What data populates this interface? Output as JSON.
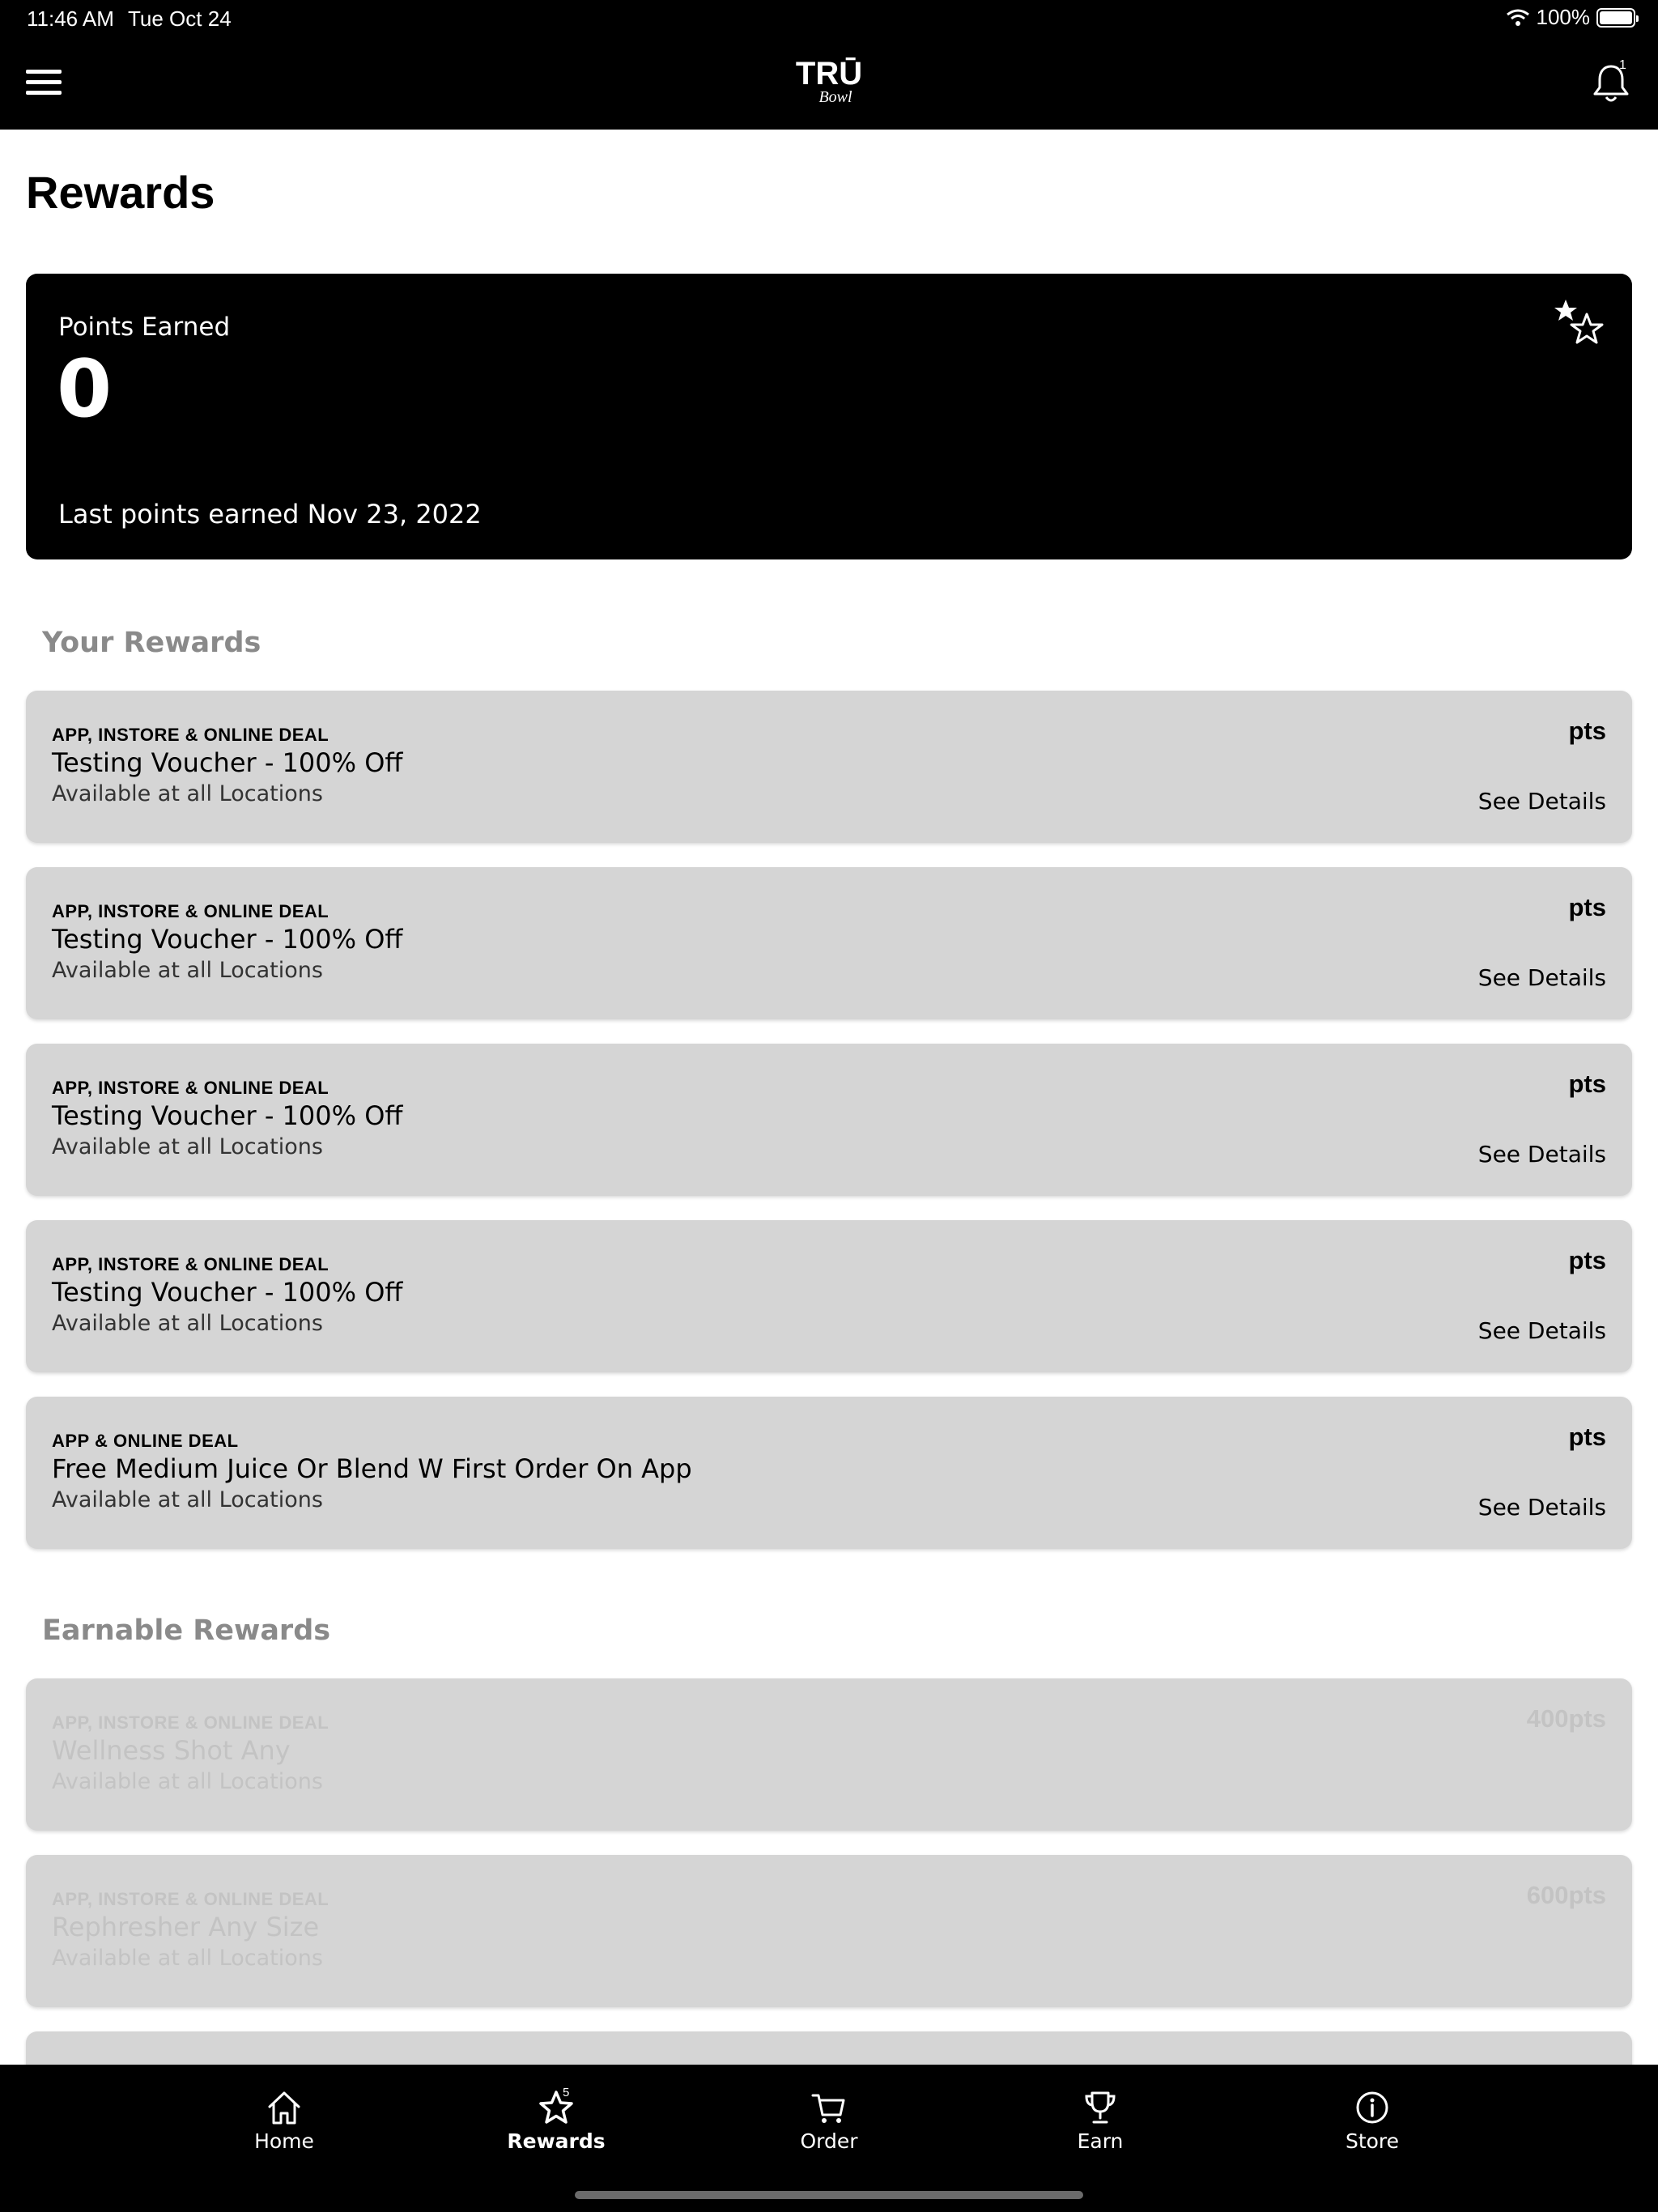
{
  "status_bar": {
    "time": "11:46 AM",
    "date": "Tue Oct 24",
    "battery": "100%"
  },
  "header": {
    "logo_text": "TRŪ",
    "logo_script": "Bowl",
    "notification_count": "1"
  },
  "page_title": "Rewards",
  "points_card": {
    "label": "Points Earned",
    "value": "0",
    "last_earned": "Last points earned Nov 23, 2022"
  },
  "your_rewards": {
    "heading": "Your Rewards",
    "items": [
      {
        "type": "APP, INSTORE & ONLINE DEAL",
        "title": "Testing Voucher - 100% Off",
        "location": "Available at all Locations",
        "points": "pts",
        "details": "See Details"
      },
      {
        "type": "APP, INSTORE & ONLINE DEAL",
        "title": "Testing Voucher - 100% Off",
        "location": "Available at all Locations",
        "points": "pts",
        "details": "See Details"
      },
      {
        "type": "APP, INSTORE & ONLINE DEAL",
        "title": "Testing Voucher - 100% Off",
        "location": "Available at all Locations",
        "points": "pts",
        "details": "See Details"
      },
      {
        "type": "APP, INSTORE & ONLINE DEAL",
        "title": "Testing Voucher - 100% Off",
        "location": "Available at all Locations",
        "points": "pts",
        "details": "See Details"
      },
      {
        "type": "APP & ONLINE DEAL",
        "title": "Free Medium Juice Or Blend W First Order On App",
        "location": "Available at all Locations",
        "points": "pts",
        "details": "See Details"
      }
    ]
  },
  "earnable_rewards": {
    "heading": "Earnable Rewards",
    "items": [
      {
        "type": "APP, INSTORE & ONLINE DEAL",
        "title": "Wellness Shot Any",
        "location": "Available at all Locations",
        "points": "400pts"
      },
      {
        "type": "APP, INSTORE & ONLINE DEAL",
        "title": "Rephresher Any Size",
        "location": "Available at all Locations",
        "points": "600pts"
      }
    ]
  },
  "tabbar": {
    "home": "Home",
    "rewards": "Rewards",
    "rewards_badge": "5",
    "order": "Order",
    "earn": "Earn",
    "store": "Store"
  }
}
